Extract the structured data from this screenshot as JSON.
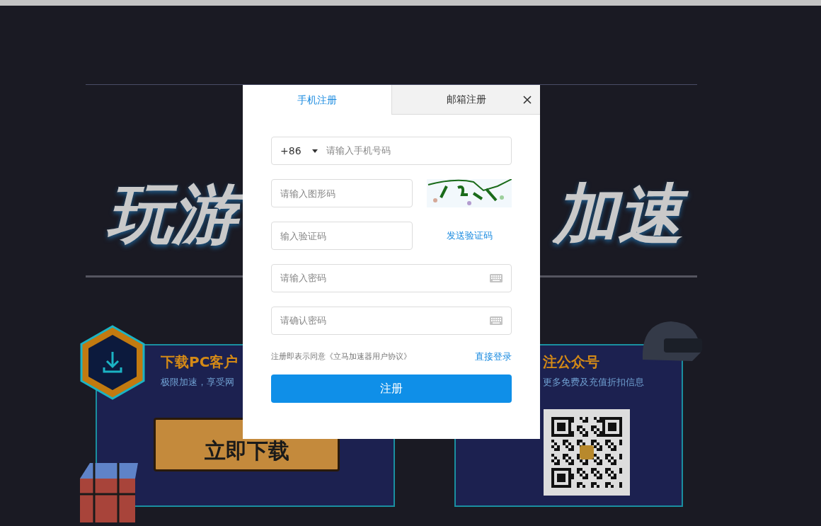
{
  "hero": {
    "title_left": "玩游",
    "title_right": "加速"
  },
  "download_card": {
    "title": "下载PC客户",
    "subtitle": "极限加速，享受网",
    "button": "立即下载"
  },
  "wechat_card": {
    "title": "注公众号",
    "subtitle": "更多免费及充值折扣信息"
  },
  "dialog": {
    "tabs": [
      {
        "label": "手机注册",
        "selected": true
      },
      {
        "label": "邮箱注册",
        "selected": false
      }
    ],
    "phone": {
      "country_code": "+86",
      "placeholder": "请输入手机号码"
    },
    "captcha": {
      "placeholder": "请输入图形码"
    },
    "sms": {
      "placeholder": "输入验证码",
      "button": "发送验证码"
    },
    "password": {
      "placeholder": "请输入密码"
    },
    "confirm": {
      "placeholder": "请确认密码"
    },
    "agreement": "注册即表示同意《立马加速器用户协议》",
    "login_link": "直接登录",
    "submit": "注册"
  }
}
